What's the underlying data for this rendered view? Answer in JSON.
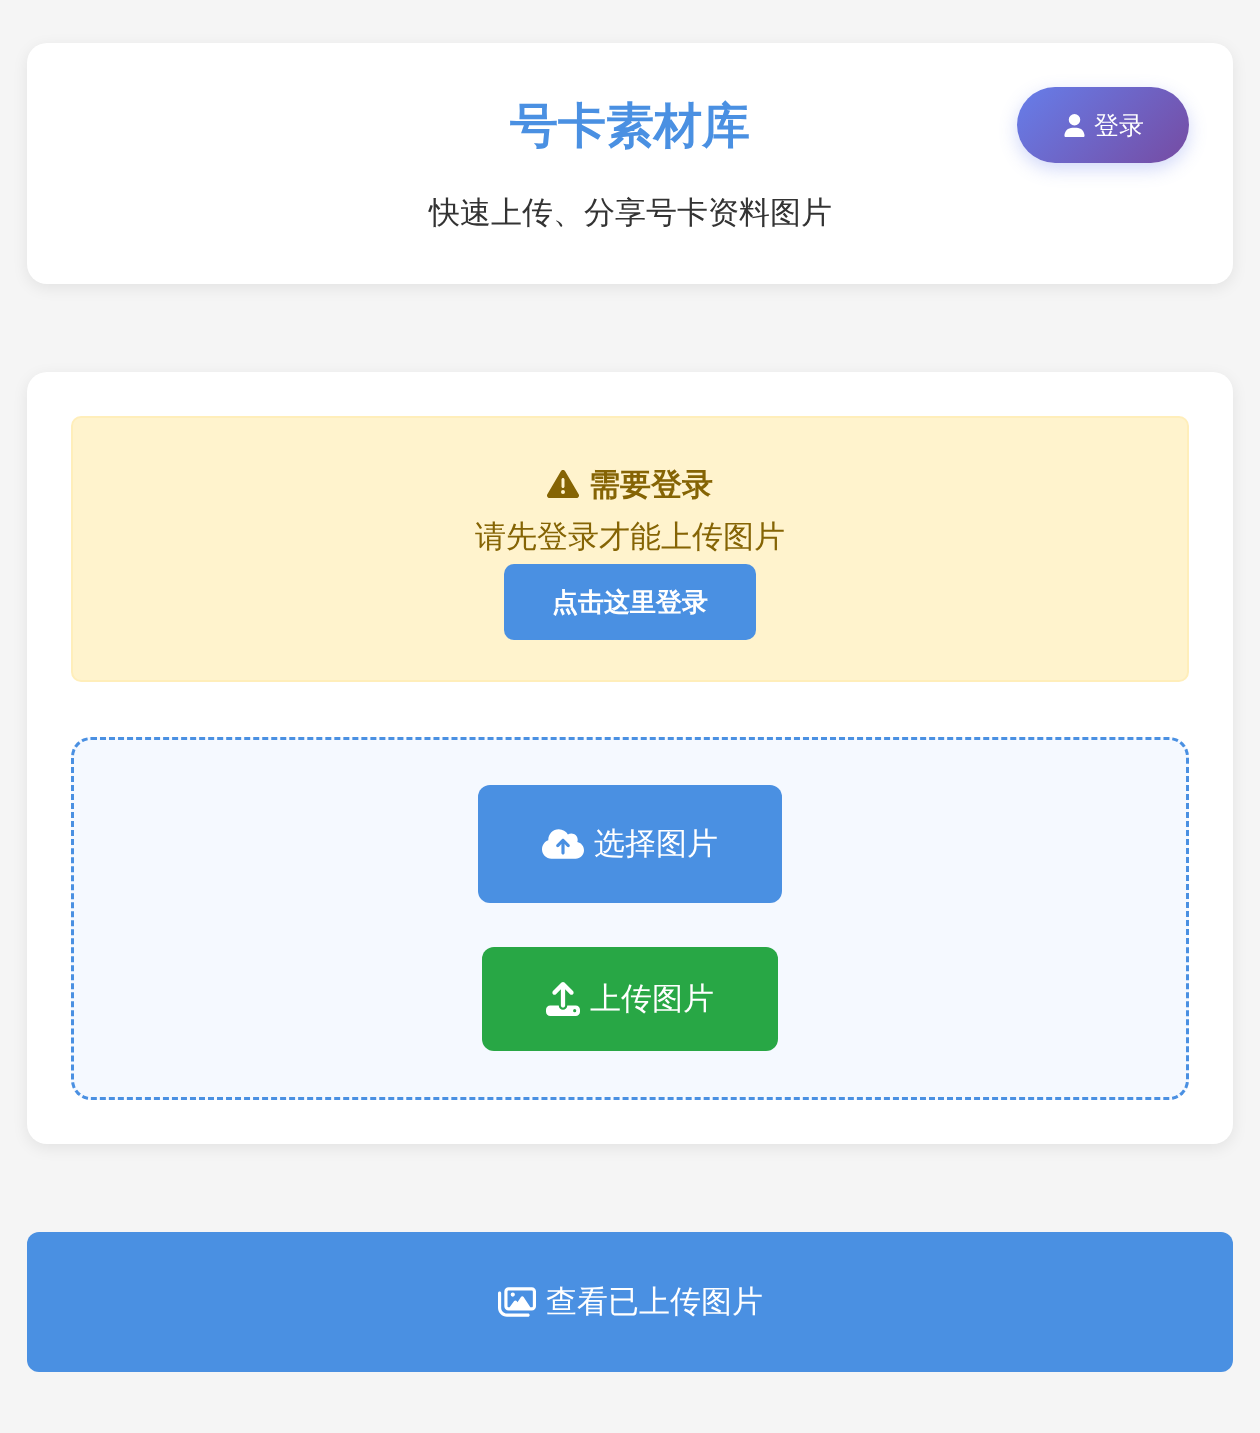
{
  "header": {
    "title": "号卡素材库",
    "subtitle": "快速上传、分享号卡资料图片",
    "login_button": {
      "label": "登录"
    }
  },
  "login_notice": {
    "title": "需要登录",
    "message": "请先登录才能上传图片",
    "button": "点击这里登录"
  },
  "upload_area": {
    "buttons": [
      {
        "kind": "select",
        "label": "选择图片"
      },
      {
        "kind": "upload",
        "label": "上传图片"
      }
    ]
  },
  "view_button": {
    "label": "查看已上传图片"
  }
}
